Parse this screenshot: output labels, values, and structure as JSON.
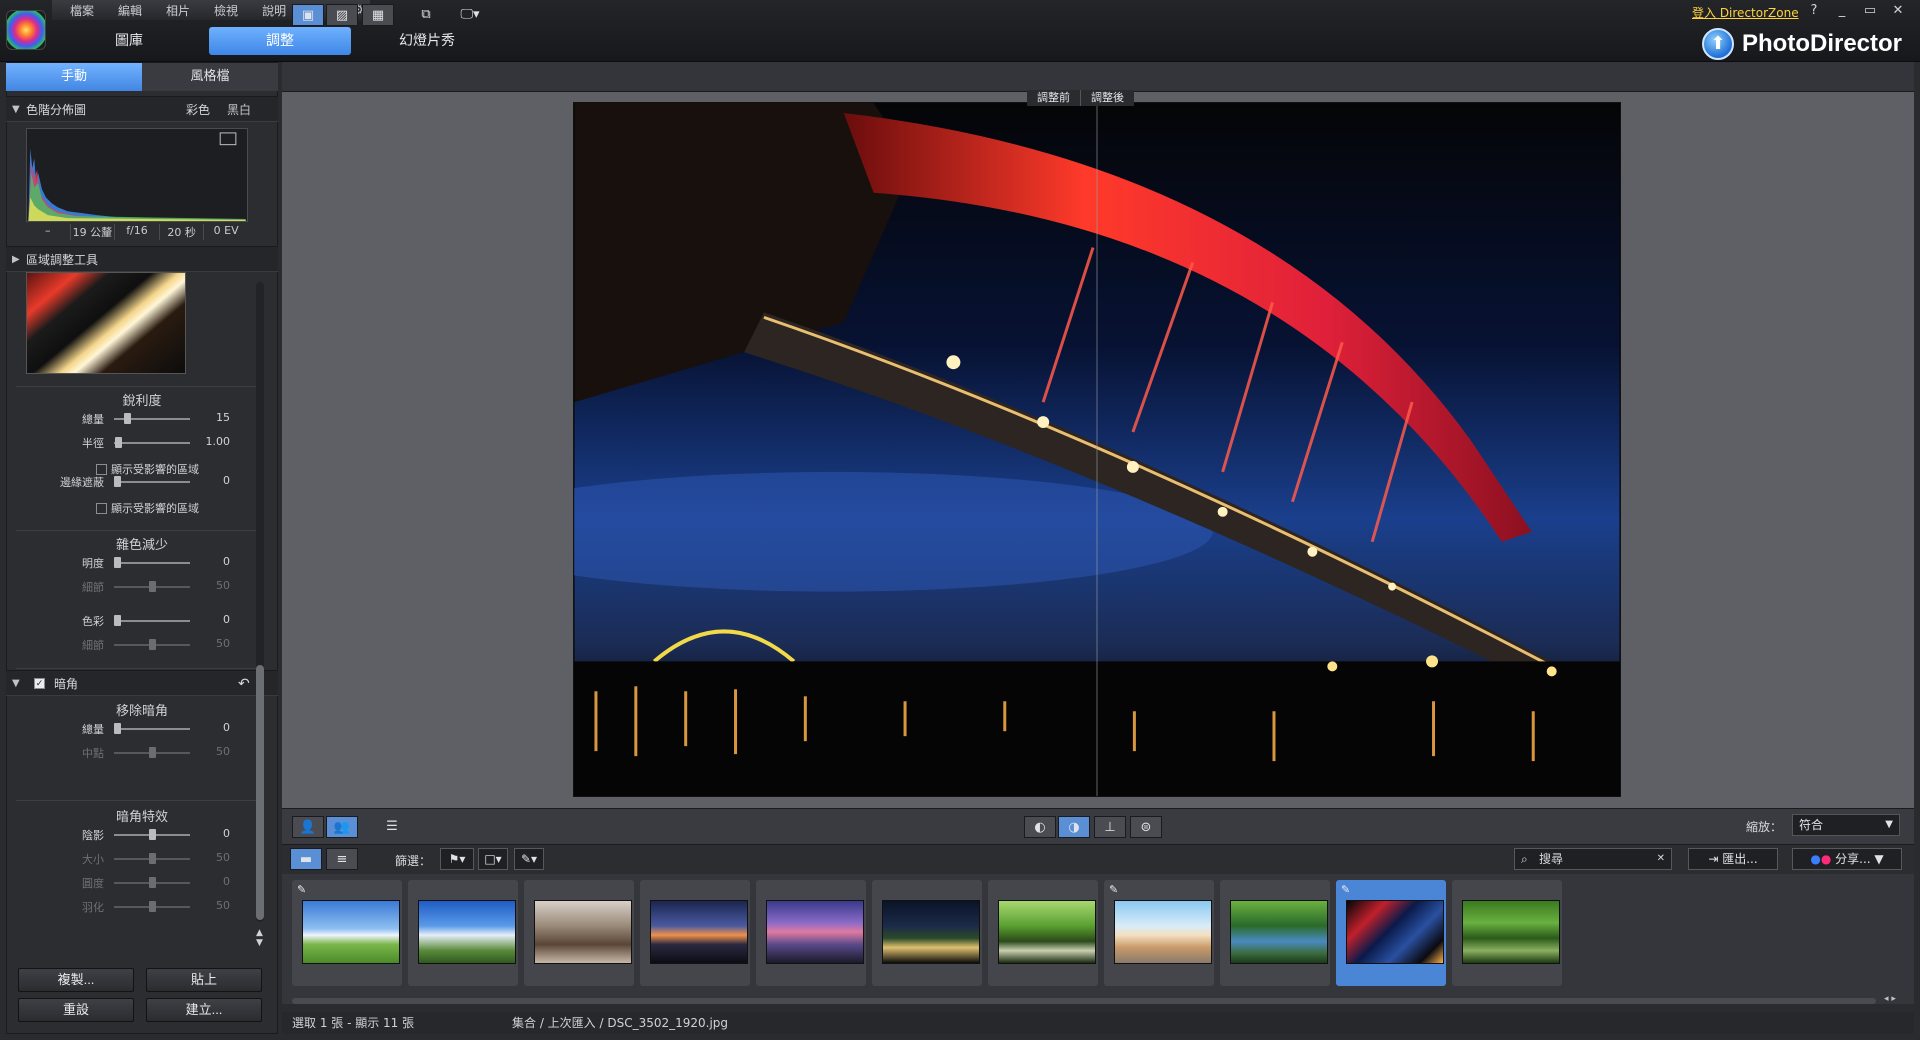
{
  "menu": {
    "items": [
      "檔案",
      "編輯",
      "相片",
      "檢視",
      "說明"
    ],
    "undo_icon": "undo-icon",
    "redo_icon": "redo-icon",
    "settings_icon": "gear-icon"
  },
  "main_tabs": [
    "圖庫",
    "調整",
    "幻燈片秀"
  ],
  "active_main_tab": "調整",
  "top_right": {
    "login": "登入 DirectorZone",
    "help": "?",
    "minimize": "_",
    "restore": "▭",
    "close": "✕",
    "brand": "PhotoDirector"
  },
  "left_panel": {
    "subtabs": [
      "手動",
      "風格檔"
    ],
    "histogram": {
      "title": "色階分佈圖",
      "color": "彩色",
      "bw": "黑白",
      "info": [
        "–",
        "19 公釐",
        "f/16",
        "20 秒",
        "0 EV"
      ]
    },
    "region_tool": {
      "title": "區域調整工具"
    },
    "sharpness": {
      "title": "銳利度",
      "amount_label": "總量",
      "amount_value": "15",
      "amount_level": 0.15,
      "radius_label": "半徑",
      "radius_value": "1.00",
      "radius_level": 0.02,
      "show_affected": "顯示受影響的區域",
      "edge_mask_label": "邊緣遮蔽",
      "edge_mask_value": "0",
      "edge_mask_level": 0,
      "show_affected_2": "顯示受影響的區域"
    },
    "noise": {
      "title": "雜色減少",
      "lum_label": "明度",
      "lum_value": "0",
      "lum_level": 0,
      "lum_detail_label": "細節",
      "lum_detail_value": "50",
      "lum_detail_level": 0.5,
      "color_label": "色彩",
      "color_value": "0",
      "color_level": 0,
      "color_detail_label": "細節",
      "color_detail_value": "50",
      "color_detail_level": 0.5
    },
    "vignette": {
      "title": "暗角",
      "checked": true,
      "removal_title": "移除暗角",
      "amount_label": "總量",
      "amount_value": "0",
      "amount_level": 0,
      "mid_label": "中點",
      "mid_value": "50",
      "mid_level": 0.5,
      "effect_title": "暗角特效",
      "shadow_label": "陰影",
      "shadow_value": "0",
      "shadow_level": 0.5,
      "size_label": "大小",
      "size_value": "50",
      "size_level": 0.5,
      "roundness_label": "圓度",
      "roundness_value": "0",
      "roundness_level": 0.5,
      "feather_label": "羽化",
      "feather_value": "50",
      "feather_level": 0.5
    },
    "buttons": {
      "copy": "複製...",
      "paste": "貼上",
      "reset": "重設",
      "create": "建立..."
    }
  },
  "canvas": {
    "before_tag": "調整前",
    "after_tag": "調整後"
  },
  "bottom": {
    "zoom_label": "縮放：",
    "zoom_value": "符合",
    "filter_label": "篩選：",
    "search_placeholder": "搜尋",
    "export": "匯出...",
    "share": "分享..."
  },
  "filmstrip": [
    {
      "edited": true,
      "selected": false,
      "theme": "grass-sky"
    },
    {
      "edited": false,
      "selected": false,
      "theme": "blue-sky"
    },
    {
      "edited": false,
      "selected": false,
      "theme": "bare-tree"
    },
    {
      "edited": false,
      "selected": false,
      "theme": "sunset-sea"
    },
    {
      "edited": false,
      "selected": false,
      "theme": "purple-dusk"
    },
    {
      "edited": false,
      "selected": false,
      "theme": "night-garden"
    },
    {
      "edited": false,
      "selected": false,
      "theme": "green-forest"
    },
    {
      "edited": true,
      "selected": false,
      "theme": "beach-toy"
    },
    {
      "edited": false,
      "selected": false,
      "theme": "stream-trees"
    },
    {
      "edited": true,
      "selected": true,
      "theme": "night-bridge"
    },
    {
      "edited": false,
      "selected": false,
      "theme": "forest-river"
    }
  ],
  "status": {
    "selection": "選取 1 張 - 顯示 11 張",
    "path": "集合 / 上次匯入 / DSC_3502_1920.jpg"
  }
}
